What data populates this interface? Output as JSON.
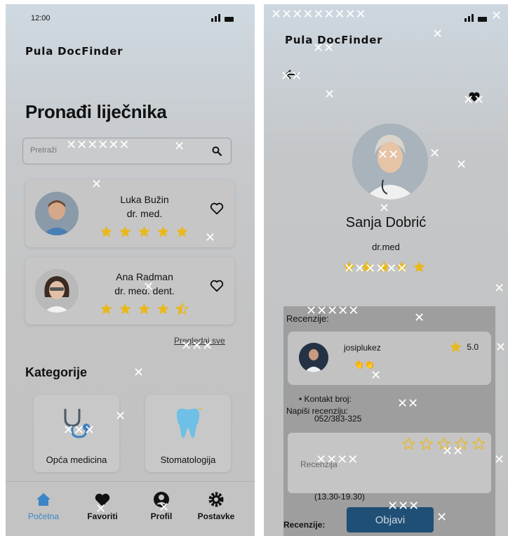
{
  "left_screen": {
    "status": {
      "time": "12:00"
    },
    "app_title": "Pula DocFinder",
    "page_title": "Pronađi liječnika",
    "search": {
      "placeholder": "Pretraži"
    },
    "doctors": [
      {
        "name": "Luka Bužin",
        "title": "dr. med.",
        "rating": 5,
        "favorite": false
      },
      {
        "name": "Ana Radman",
        "title": "dr. med. dent.",
        "rating": 4.5,
        "favorite": false
      }
    ],
    "view_all_label": "Pregledaj sve",
    "categories_title": "Kategorije",
    "categories": [
      {
        "label": "Opća medicina",
        "icon": "stethoscope-icon"
      },
      {
        "label": "Stomatologija",
        "icon": "tooth-icon"
      }
    ],
    "nav": [
      {
        "label": "Početna",
        "icon": "home-icon",
        "active": true
      },
      {
        "label": "Favoriti",
        "icon": "heart-icon",
        "active": false
      },
      {
        "label": "Profil",
        "icon": "user-icon",
        "active": false
      },
      {
        "label": "Postavke",
        "icon": "gear-icon",
        "active": false
      }
    ]
  },
  "right_screen": {
    "app_title": "Pula DocFinder",
    "doctor": {
      "name": "Sanja Dobrić",
      "title": "dr.med",
      "rating": 5
    },
    "reviews_label": "Recenzije:",
    "review": {
      "user": "josiplukez",
      "emoji": "👏👏",
      "score": "5.0"
    },
    "contact_label": "Kontakt broj:",
    "contact_number": "052/383-325",
    "write_review_label": "Napiši recenziju:",
    "review_placeholder": "Recenzija",
    "hours": "(13.30-19.30)",
    "reviews_bottom_label": "Recenzije:",
    "publish_label": "Objavi"
  },
  "colors": {
    "star": "#e8b81c",
    "accent": "#3b86c7",
    "publish_button": "#1f4f75"
  }
}
